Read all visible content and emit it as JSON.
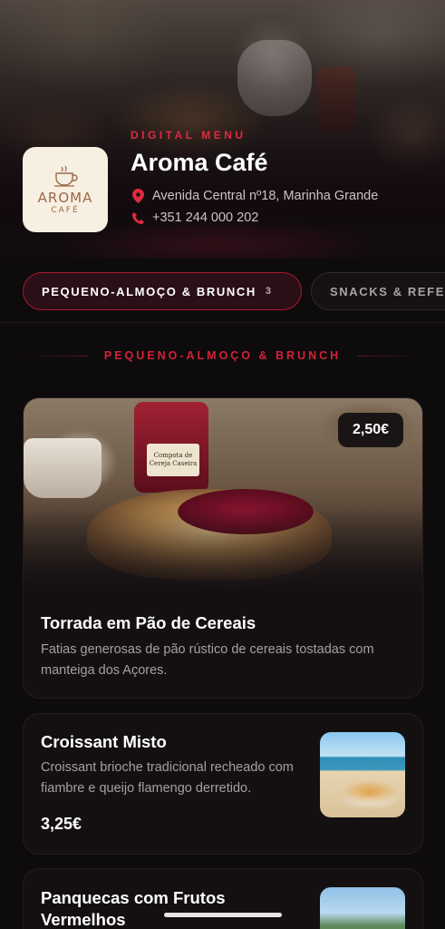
{
  "header": {
    "eyebrow": "DIGITAL MENU",
    "title": "Aroma Café",
    "address": "Avenida Central nº18, Marinha Grande",
    "phone": "+351 244 000 202",
    "logo": {
      "word": "AROMA",
      "sub": "CAFÉ",
      "icon": "coffee-cup-icon"
    }
  },
  "tabs": [
    {
      "label": "PEQUENO-ALMOÇO & BRUNCH",
      "count": "3",
      "active": true
    },
    {
      "label": "SNACKS & REFE",
      "active": false
    }
  ],
  "section": {
    "title": "PEQUENO-ALMOÇO & BRUNCH"
  },
  "items": [
    {
      "name": "Torrada em Pão de Cereais",
      "description": "Fatias generosas de pão rústico de cereais tostadas com manteiga dos Açores.",
      "price": "2,50€",
      "jar_label": "Compota de Cereja Caseira"
    },
    {
      "name": "Croissant Misto",
      "description": "Croissant brioche tradicional recheado com fiambre e queijo flamengo derretido.",
      "price": "3,25€"
    },
    {
      "name": "Panquecas com Frutos Vermelhos",
      "description": "",
      "price": ""
    }
  ],
  "colors": {
    "accent": "#e02a40",
    "background": "#0d0b0c",
    "card": "#141012"
  }
}
